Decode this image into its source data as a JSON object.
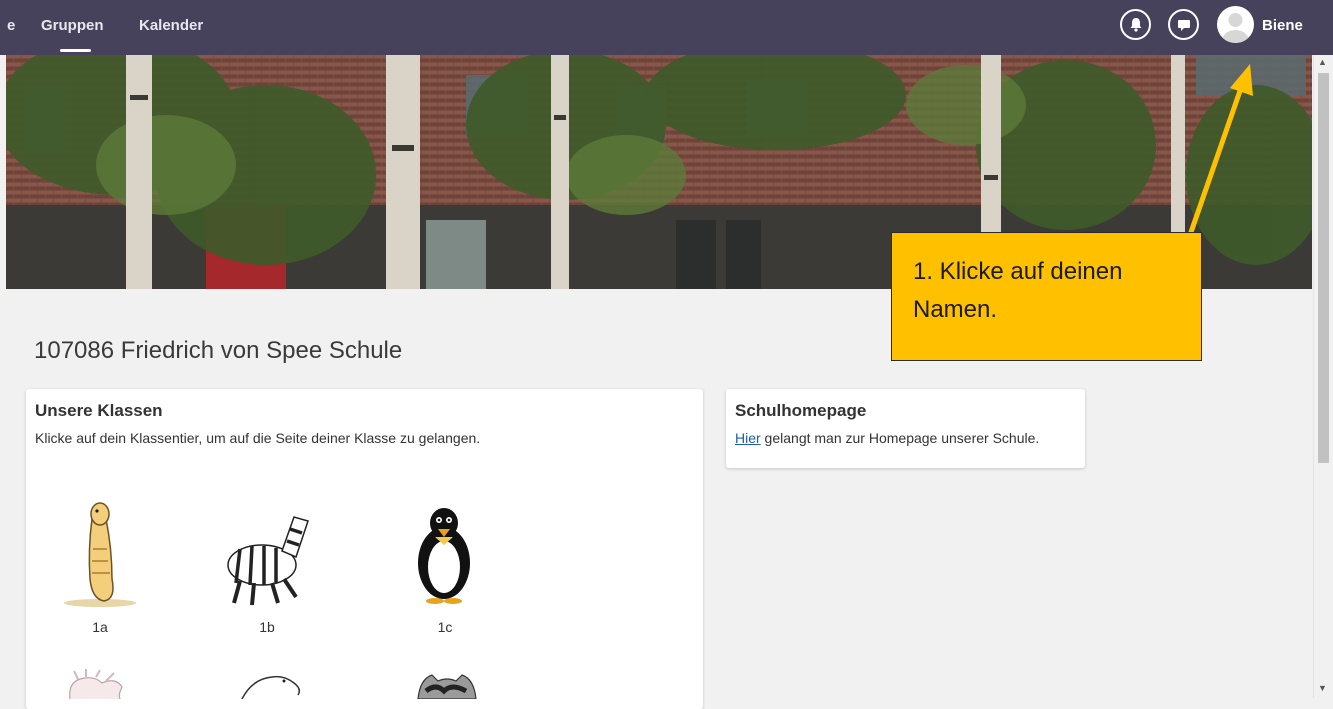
{
  "nav": {
    "partial_item": "e",
    "groups": "Gruppen",
    "calendar": "Kalender",
    "bell_icon": "bell-icon",
    "chat_icon": "chat-bubble-icon",
    "user_name": "Biene"
  },
  "school": {
    "title": "107086 Friedrich von Spee Schule"
  },
  "classes_card": {
    "title": "Unsere Klassen",
    "description": "Klicke auf dein Klassentier, um auf die Seite deiner Klasse zu gelangen.",
    "classes": [
      {
        "label": "1a",
        "animal": "meerkat"
      },
      {
        "label": "1b",
        "animal": "zebra"
      },
      {
        "label": "1c",
        "animal": "penguin"
      }
    ],
    "next_row_animals": [
      "axolotl",
      "beaver",
      "raccoon"
    ]
  },
  "homepage_card": {
    "title": "Schulhomepage",
    "link_text": "Hier",
    "text_rest": " gelangt man zur Homepage unserer Schule."
  },
  "callout": {
    "text": "1. Klicke auf deinen Namen.",
    "background": "#ffc000"
  },
  "colors": {
    "topbar": "#46425b",
    "link": "#1a5fa8"
  }
}
